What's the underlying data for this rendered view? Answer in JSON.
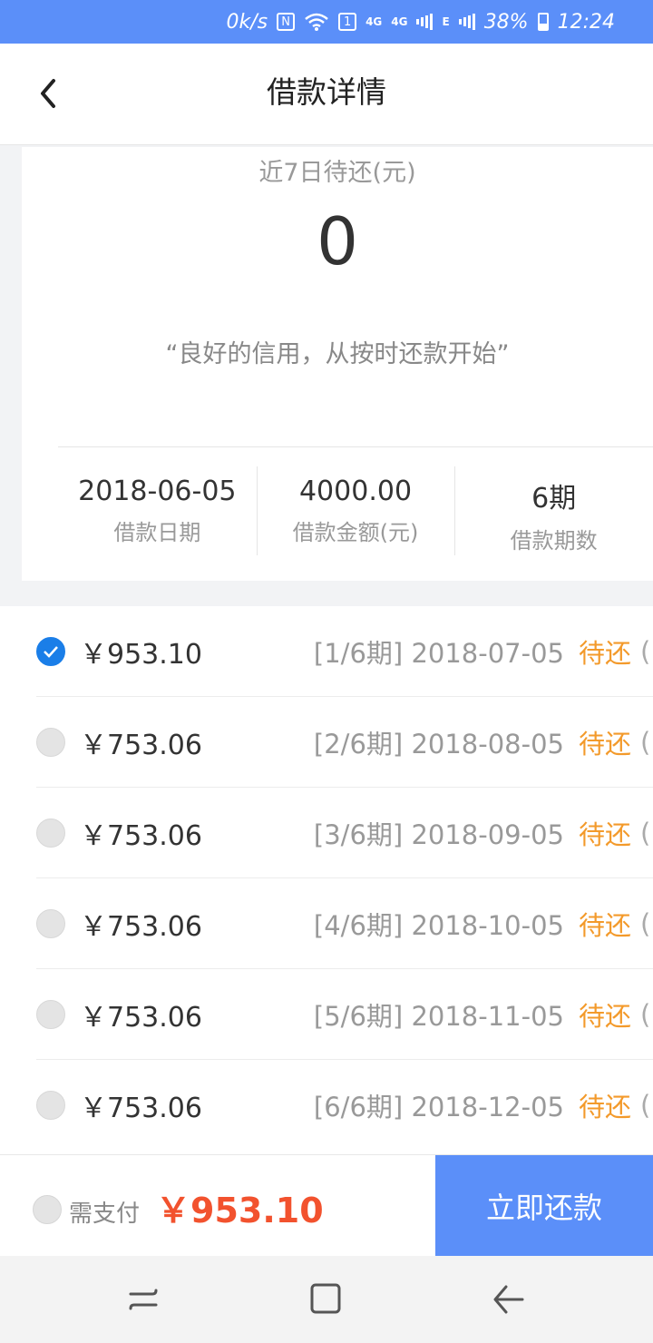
{
  "status_bar": {
    "speed": "0k/s",
    "nfc": "N",
    "wifi_badge": "1",
    "net_1": "4G",
    "net_2": "4G",
    "net_3": "E",
    "battery": "38%",
    "time": "12:24"
  },
  "header": {
    "title": "借款详情",
    "back_icon": "chevron-left-icon"
  },
  "summary": {
    "label": "近7日待还(元)",
    "amount": "0",
    "slogan": "“良好的信用，从按时还款开始”",
    "stats": [
      {
        "value": "2018-06-05",
        "label": "借款日期"
      },
      {
        "value": "4000.00",
        "label": "借款金额(元)"
      },
      {
        "value": "6期",
        "label": "借款期数"
      }
    ]
  },
  "installments": [
    {
      "amount": "￥953.10",
      "period": "[1/6期] 2018-07-05",
      "status": "待还",
      "checked": true
    },
    {
      "amount": "￥753.06",
      "period": "[2/6期] 2018-08-05",
      "status": "待还",
      "checked": false
    },
    {
      "amount": "￥753.06",
      "period": "[3/6期] 2018-09-05",
      "status": "待还",
      "checked": false
    },
    {
      "amount": "￥753.06",
      "period": "[4/6期] 2018-10-05",
      "status": "待还",
      "checked": false
    },
    {
      "amount": "￥753.06",
      "period": "[5/6期] 2018-11-05",
      "status": "待还",
      "checked": false
    },
    {
      "amount": "￥753.06",
      "period": "[6/6期] 2018-12-05",
      "status": "待还",
      "checked": false
    }
  ],
  "pay_bar": {
    "label": "需支付",
    "amount": "￥953.10",
    "button": "立即还款"
  },
  "colors": {
    "accent": "#5b8ff9",
    "checked": "#1a7ee8",
    "pending_status": "#f39a2b",
    "pay_amount": "#f2522e"
  }
}
